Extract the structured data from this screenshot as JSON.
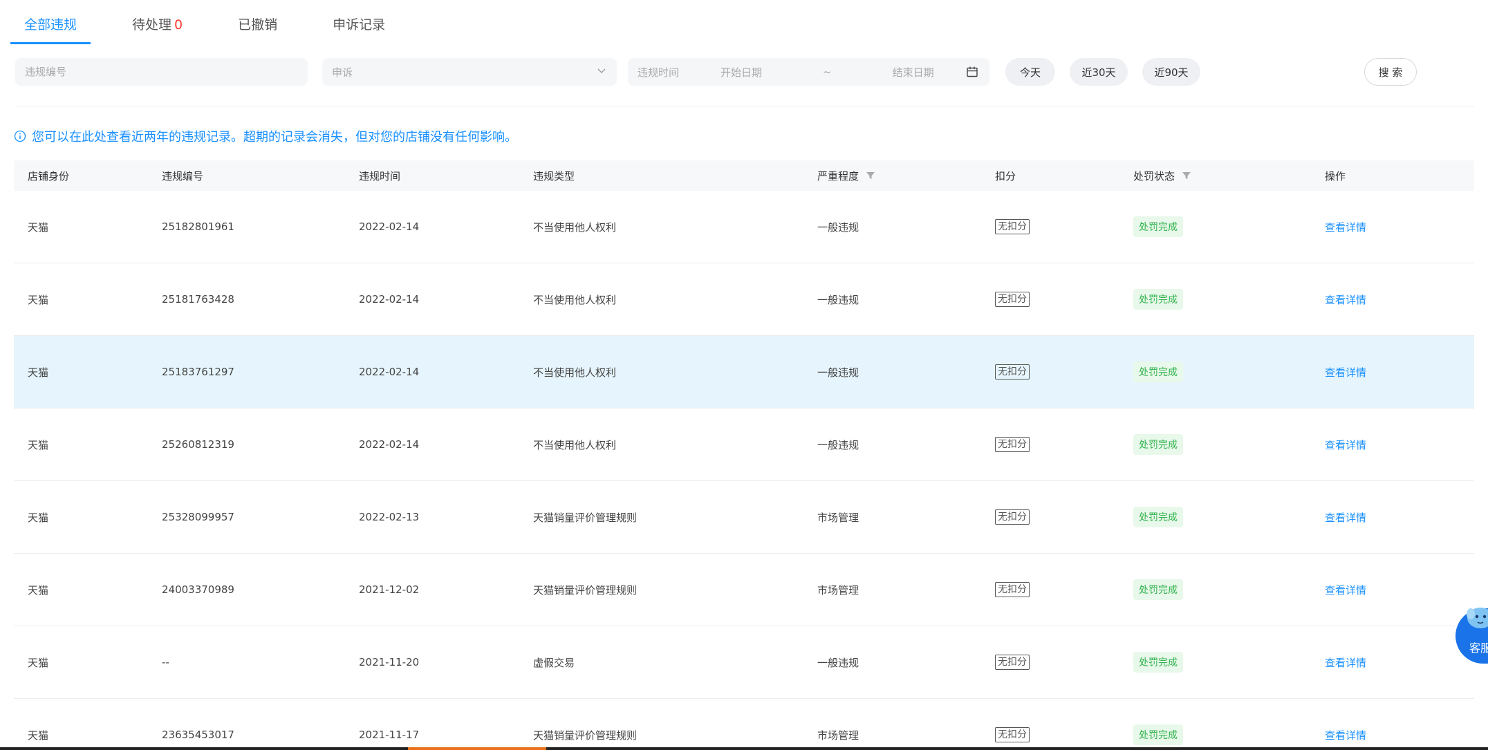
{
  "tabs": [
    {
      "label": "全部违规"
    },
    {
      "label": "待处理",
      "count": "0"
    },
    {
      "label": "已撤销"
    },
    {
      "label": "申诉记录"
    }
  ],
  "filters": {
    "violation_no_placeholder": "违规编号",
    "appeal_select_value": "申诉",
    "date_label": "违规时间",
    "date_start_placeholder": "开始日期",
    "date_separator": "~",
    "date_end_placeholder": "结束日期",
    "quick_ranges": [
      "今天",
      "近30天",
      "近90天"
    ],
    "search_label": "搜 索"
  },
  "notice": "您可以在此处查看近两年的违规记录。超期的记录会消失，但对您的店铺没有任何影响。",
  "table": {
    "columns": [
      "店铺身份",
      "违规编号",
      "违规时间",
      "违规类型",
      "严重程度",
      "扣分",
      "处罚状态",
      "操作"
    ],
    "rows": [
      {
        "shop": "天猫",
        "id": "25182801961",
        "date": "2022-02-14",
        "type": "不当使用他人权利",
        "severity": "一般违规",
        "score": "无扣分",
        "status": "处罚完成",
        "action": "查看详情",
        "highlight": false
      },
      {
        "shop": "天猫",
        "id": "25181763428",
        "date": "2022-02-14",
        "type": "不当使用他人权利",
        "severity": "一般违规",
        "score": "无扣分",
        "status": "处罚完成",
        "action": "查看详情",
        "highlight": false
      },
      {
        "shop": "天猫",
        "id": "25183761297",
        "date": "2022-02-14",
        "type": "不当使用他人权利",
        "severity": "一般违规",
        "score": "无扣分",
        "status": "处罚完成",
        "action": "查看详情",
        "highlight": true
      },
      {
        "shop": "天猫",
        "id": "25260812319",
        "date": "2022-02-14",
        "type": "不当使用他人权利",
        "severity": "一般违规",
        "score": "无扣分",
        "status": "处罚完成",
        "action": "查看详情",
        "highlight": false
      },
      {
        "shop": "天猫",
        "id": "25328099957",
        "date": "2022-02-13",
        "type": "天猫销量评价管理规则",
        "severity": "市场管理",
        "score": "无扣分",
        "status": "处罚完成",
        "action": "查看详情",
        "highlight": false
      },
      {
        "shop": "天猫",
        "id": "24003370989",
        "date": "2021-12-02",
        "type": "天猫销量评价管理规则",
        "severity": "市场管理",
        "score": "无扣分",
        "status": "处罚完成",
        "action": "查看详情",
        "highlight": false
      },
      {
        "shop": "天猫",
        "id": "--",
        "date": "2021-11-20",
        "type": "虚假交易",
        "severity": "一般违规",
        "score": "无扣分",
        "status": "处罚完成",
        "action": "查看详情",
        "highlight": false
      },
      {
        "shop": "天猫",
        "id": "23635453017",
        "date": "2021-11-17",
        "type": "天猫销量评价管理规则",
        "severity": "市场管理",
        "score": "无扣分",
        "status": "处罚完成",
        "action": "查看详情",
        "highlight": false
      }
    ]
  },
  "customer_service": {
    "label": "客服"
  },
  "colors": {
    "accent": "#1890ff",
    "status_green": "#30b34d",
    "row_highlight": "#e6f5fd",
    "pending_count": "#ff3b30"
  }
}
